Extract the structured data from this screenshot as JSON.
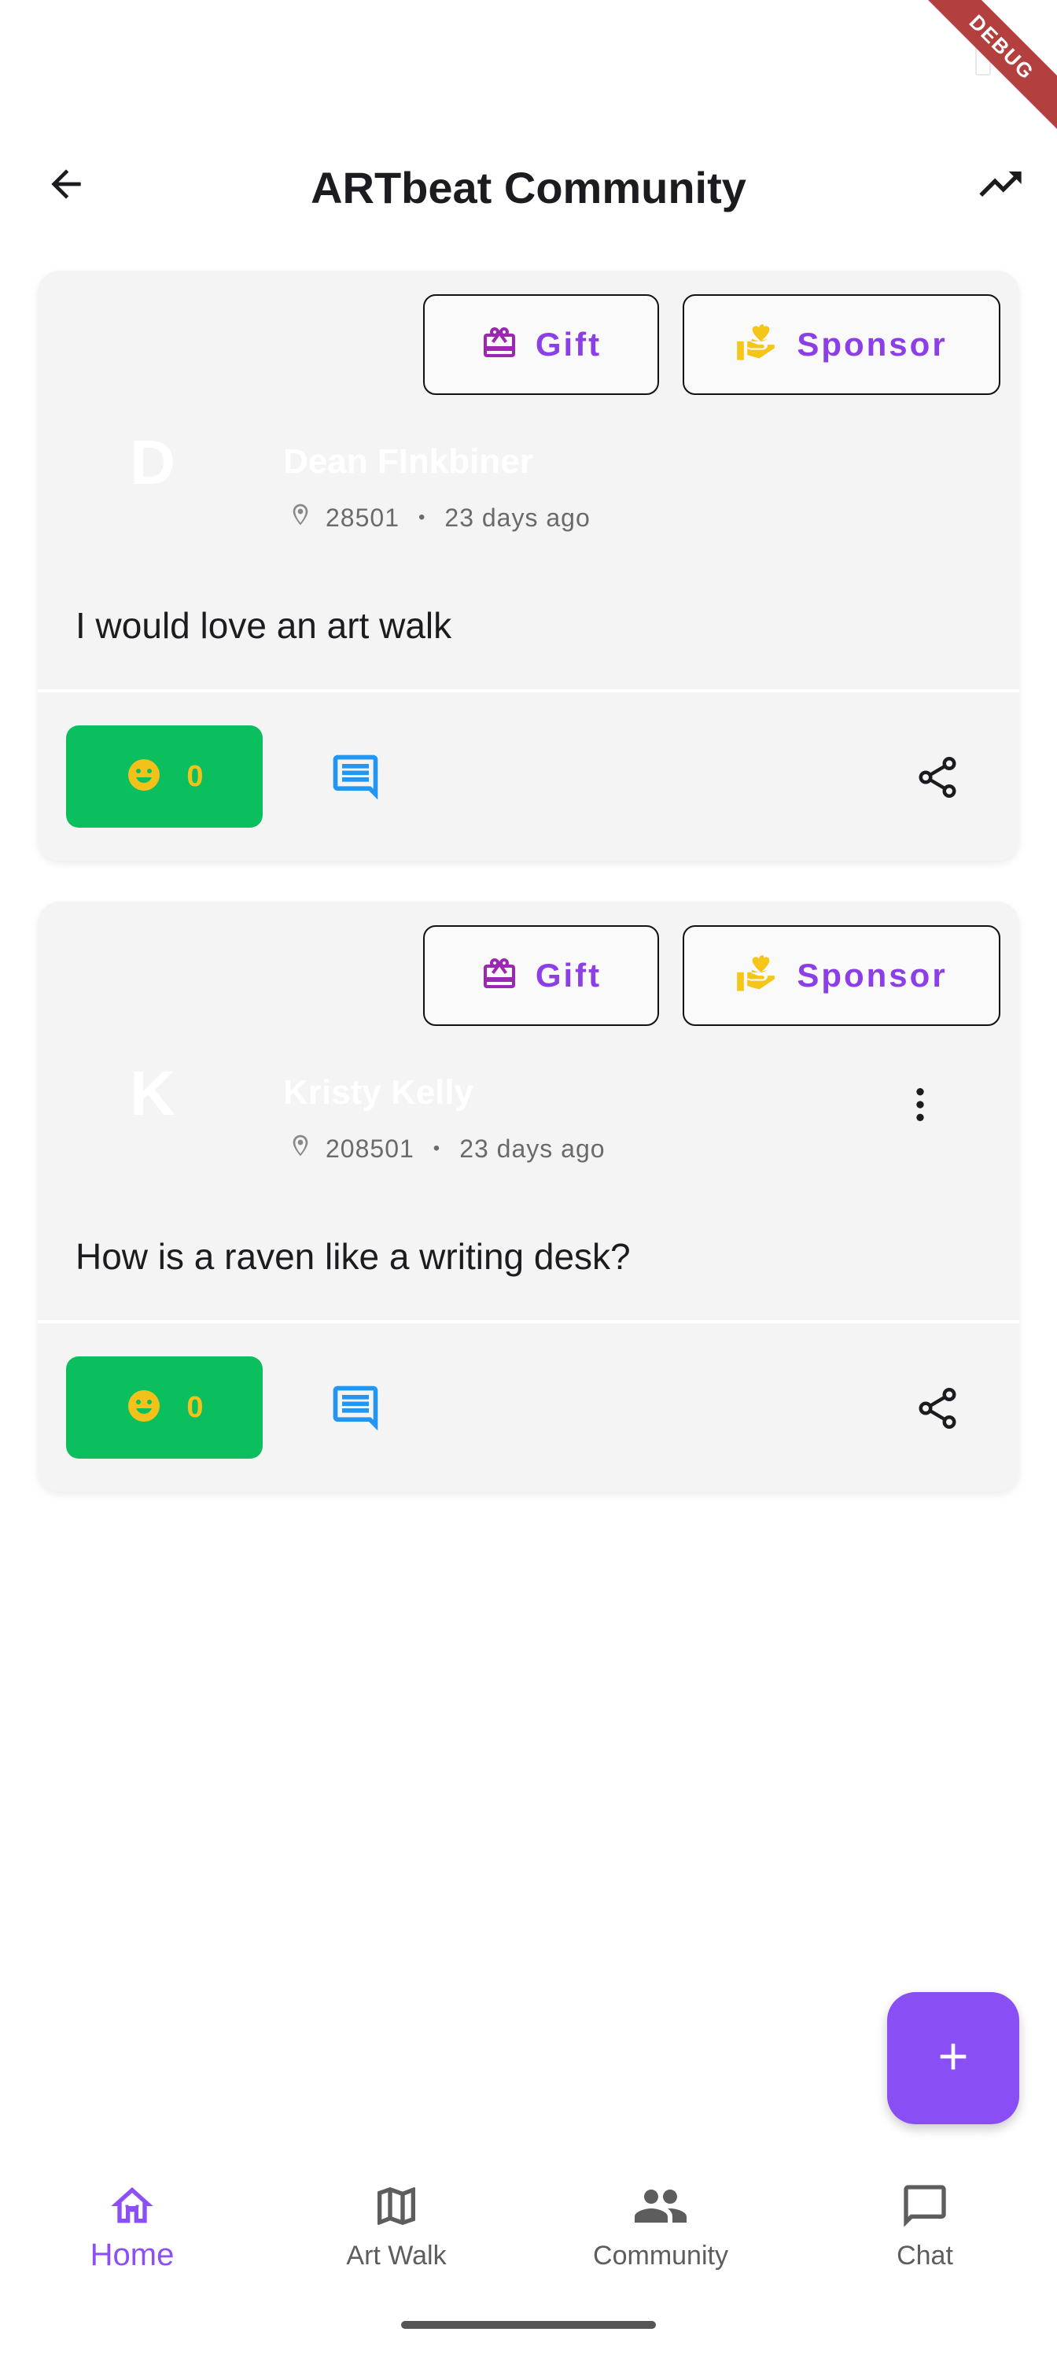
{
  "debug_banner": "DEBUG",
  "appbar": {
    "title": "ARTbeat Community",
    "back_icon": "arrow-left-icon",
    "trending_icon": "trending-up-icon"
  },
  "posts": [
    {
      "gift_label": "Gift",
      "sponsor_label": "Sponsor",
      "avatar_letter": "D",
      "username": "Dean FInkbiner",
      "location": "28501",
      "time_ago": "23 days ago",
      "text": "I would love an art walk",
      "likes": "0"
    },
    {
      "gift_label": "Gift",
      "sponsor_label": "Sponsor",
      "avatar_letter": "K",
      "username": "Kristy Kelly",
      "location": "208501",
      "time_ago": "23 days ago",
      "text": "How is a raven like a writing desk?",
      "likes": "0"
    }
  ],
  "fab_icon": "plus-icon",
  "bottom_nav": {
    "items": [
      {
        "label": "Home",
        "icon": "home-icon",
        "active": true
      },
      {
        "label": "Art Walk",
        "icon": "map-icon",
        "active": false
      },
      {
        "label": "Community",
        "icon": "people-icon",
        "active": false
      },
      {
        "label": "Chat",
        "icon": "chat-icon",
        "active": false
      }
    ]
  },
  "colors": {
    "accent": "#8c4ef5",
    "like_green": "#0bbf5e",
    "like_yellow": "#f2c21a",
    "comment_blue": "#2196f3",
    "gift_purple": "#9c27b0",
    "sponsor_gold": "#f5c518"
  }
}
